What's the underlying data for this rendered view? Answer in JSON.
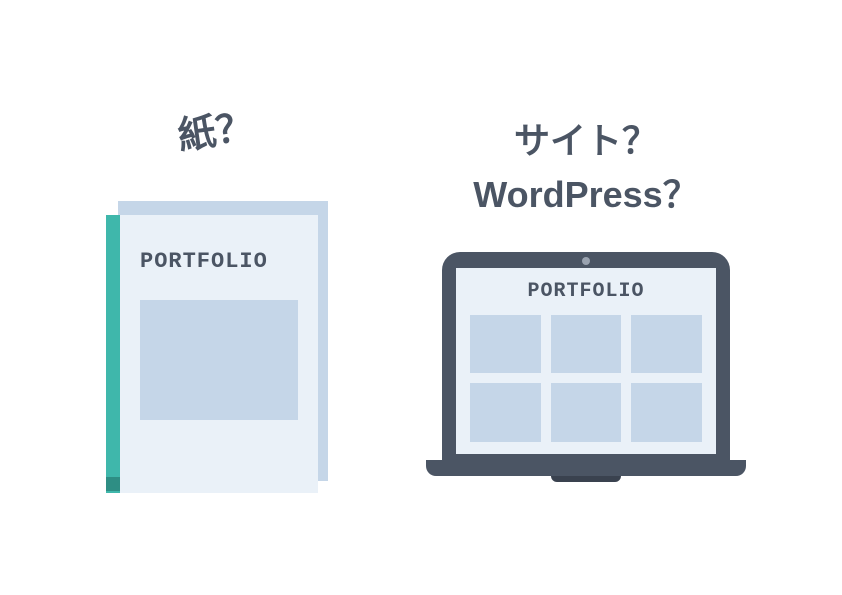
{
  "left": {
    "heading": "紙？",
    "book_title": "PORTFOLIO"
  },
  "right": {
    "heading_line1": "サイト？",
    "heading_line2": "WordPress？",
    "screen_title": "PORTFOLIO"
  },
  "colors": {
    "text": "#4b5564",
    "panel_light": "#eaf1f8",
    "panel_mid": "#c5d6e8",
    "teal": "#3fb7ab"
  }
}
